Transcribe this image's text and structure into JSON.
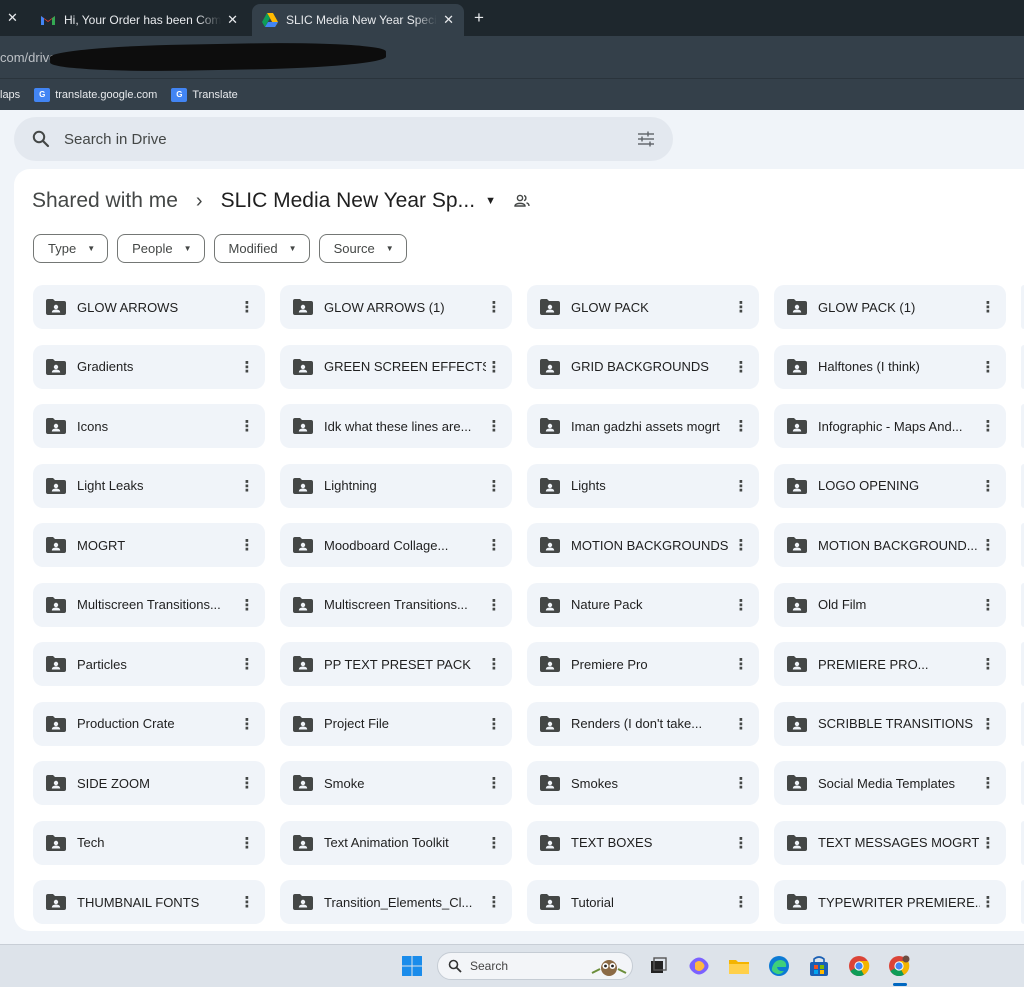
{
  "tabs": {
    "inactive_title": "Hi, Your Order has been Complete",
    "active_title": "SLIC Media New Year Special Pack",
    "new_tab": "+",
    "close": "✕"
  },
  "address": {
    "url": "com/drive"
  },
  "bookmarks": [
    {
      "label": "laps"
    },
    {
      "label": "translate.google.com"
    },
    {
      "label": "Translate"
    }
  ],
  "search": {
    "placeholder": "Search in Drive"
  },
  "breadcrumb": {
    "parent": "Shared with me",
    "separator": "›",
    "current": "SLIC Media New Year Sp..."
  },
  "filters": [
    "Type",
    "People",
    "Modified",
    "Source"
  ],
  "folders": [
    "GLOW ARROWS",
    "GLOW ARROWS (1)",
    "GLOW PACK",
    "GLOW PACK (1)",
    "Gradients",
    "GREEN SCREEN EFFECTS",
    "GRID BACKGROUNDS",
    "Halftones (I think)",
    "Icons",
    "Idk what these lines are...",
    "Iman gadzhi assets mogrt",
    "Infographic - Maps And...",
    "Light Leaks",
    "Lightning",
    "Lights",
    "LOGO OPENING",
    "MOGRT",
    "Moodboard Collage...",
    "MOTION BACKGROUNDS",
    "MOTION BACKGROUND...",
    "Multiscreen Transitions...",
    "Multiscreen Transitions...",
    "Nature Pack",
    "Old Film",
    "Particles",
    "PP TEXT PRESET PACK",
    "Premiere Pro",
    "PREMIERE PRO...",
    "Production Crate",
    "Project File",
    "Renders (I don't take...",
    "SCRIBBLE TRANSITIONS",
    "SIDE ZOOM",
    "Smoke",
    "Smokes",
    "Social Media Templates",
    "Tech",
    "Text Animation Toolkit",
    "TEXT BOXES",
    "TEXT MESSAGES MOGRT",
    "THUMBNAIL FONTS",
    "Transition_Elements_Cl...",
    "Tutorial",
    "TYPEWRITER PREMIERE..."
  ],
  "taskbar": {
    "search_label": "Search"
  },
  "colors": {
    "folder_bg": "#f0f4f9",
    "panel_bg": "#ffffff",
    "search_bg": "#e3e8ef"
  }
}
